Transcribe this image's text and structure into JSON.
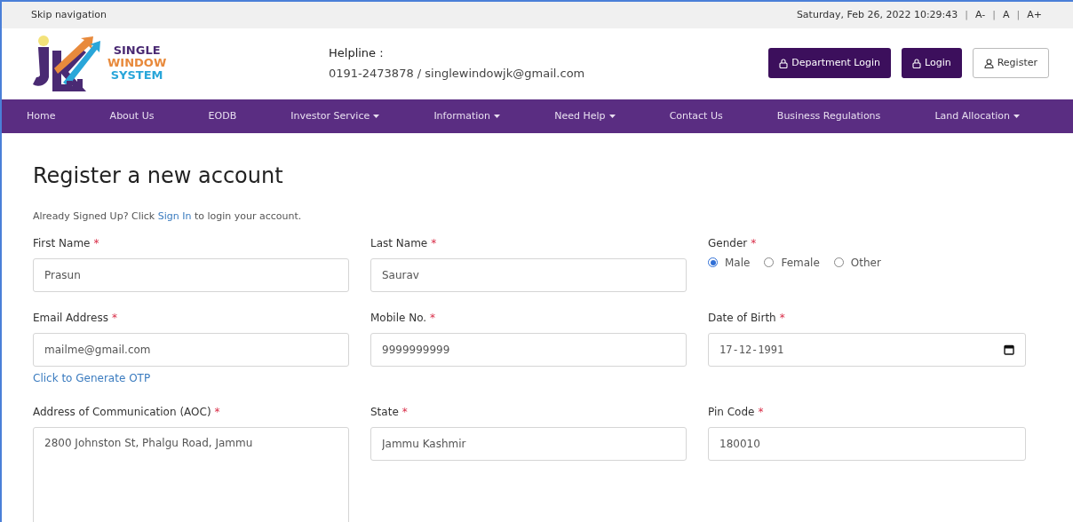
{
  "top_bar": {
    "skip_link": "Skip navigation",
    "datetime": "Saturday, Feb 26, 2022 10:29:43",
    "separator": "|",
    "font_sizes": [
      "A-",
      "A",
      "A+"
    ]
  },
  "header": {
    "logo": {
      "line_1": "SINGLE",
      "line_2": "WINDOW",
      "line_3": "SYSTEM"
    },
    "helpline_label": "Helpline :",
    "helpline_value": "0191-2473878 / singlewindowjk@gmail.com",
    "buttons": [
      {
        "label": "Department Login",
        "kind": "lock"
      },
      {
        "label": "Login",
        "kind": "lock"
      },
      {
        "label": "Register",
        "kind": "user"
      }
    ]
  },
  "nav": [
    {
      "label": "Home",
      "dropdown": false
    },
    {
      "label": "About Us",
      "dropdown": false
    },
    {
      "label": "EODB",
      "dropdown": false
    },
    {
      "label": "Investor Service",
      "dropdown": true
    },
    {
      "label": "Information",
      "dropdown": true
    },
    {
      "label": "Need Help",
      "dropdown": true
    },
    {
      "label": "Contact Us",
      "dropdown": false
    },
    {
      "label": "Business Regulations",
      "dropdown": false
    },
    {
      "label": "Land Allocation",
      "dropdown": true
    }
  ],
  "page": {
    "title": "Register a new account",
    "intro_before": "Already Signed Up? Click",
    "intro_link": "Sign In",
    "intro_after": "to login your account."
  },
  "fields": [
    {
      "label": "First Name",
      "required_mark": "*",
      "kind": "text",
      "value": "Prasun"
    },
    {
      "label": "Last Name",
      "required_mark": "*",
      "kind": "text",
      "value": "Saurav"
    },
    {
      "label": "Gender",
      "required_mark": "*",
      "kind": "radio",
      "options": [
        {
          "label": "Male",
          "selected": true
        },
        {
          "label": "Female",
          "selected": false
        },
        {
          "label": "Other",
          "selected": false
        }
      ]
    },
    {
      "label": "Email Address",
      "required_mark": "*",
      "kind": "text",
      "value": "mailme@gmail.com",
      "link": "Click to Generate OTP"
    },
    {
      "label": "Mobile No.",
      "required_mark": "*",
      "kind": "text",
      "value": "9999999999"
    },
    {
      "label": "Date of Birth",
      "required_mark": "*",
      "kind": "date",
      "value": "17-12-1991"
    },
    {
      "label": "Address of Communication (AOC)",
      "required_mark": "*",
      "kind": "textarea",
      "value": "2800 Johnston St, Phalgu Road, Jammu"
    },
    {
      "label": "State",
      "required_mark": "*",
      "kind": "text",
      "value": "Jammu Kashmir"
    },
    {
      "label": "Pin Code",
      "required_mark": "*",
      "kind": "text",
      "value": "180010"
    }
  ]
}
